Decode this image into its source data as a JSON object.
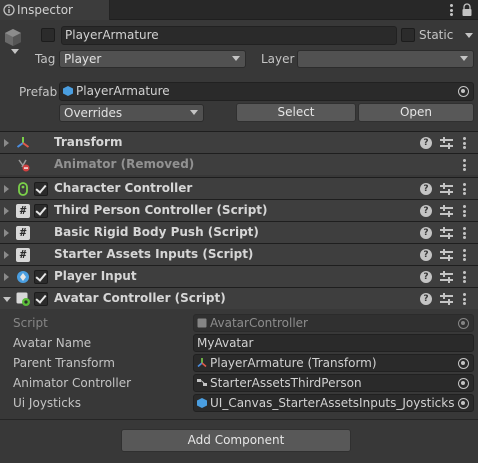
{
  "window": {
    "tab_title": "Inspector"
  },
  "header": {
    "object_name": "PlayerArmature",
    "static_label": "Static",
    "tag_label": "Tag",
    "tag_value": "Player",
    "layer_label": "Layer",
    "layer_value": "",
    "prefab_label": "Prefab",
    "prefab_value": "PlayerArmature",
    "overrides_label": "Overrides",
    "select_label": "Select",
    "open_label": "Open"
  },
  "components": [
    {
      "title": "Transform",
      "icon": "transform-icon",
      "has_checkbox": false,
      "checked": false
    },
    {
      "title": "Animator (Removed)",
      "icon": "animator-removed-icon",
      "has_checkbox": false,
      "checked": false
    },
    {
      "title": "Character Controller",
      "icon": "character-controller-icon",
      "has_checkbox": true,
      "checked": true
    },
    {
      "title": "Third Person Controller (Script)",
      "icon": "script-icon",
      "has_checkbox": true,
      "checked": true
    },
    {
      "title": "Basic Rigid Body Push (Script)",
      "icon": "script-icon",
      "has_checkbox": false,
      "checked": false
    },
    {
      "title": "Starter Assets Inputs (Script)",
      "icon": "script-icon",
      "has_checkbox": false,
      "checked": false
    },
    {
      "title": "Player Input",
      "icon": "player-input-icon",
      "has_checkbox": true,
      "checked": true
    },
    {
      "title": "Avatar Controller (Script)",
      "icon": "avatar-script-icon",
      "has_checkbox": true,
      "checked": true
    }
  ],
  "avatar_controller": {
    "script_label": "Script",
    "script_value": "AvatarController",
    "avatar_name_label": "Avatar Name",
    "avatar_name_value": "MyAvatar",
    "parent_transform_label": "Parent Transform",
    "parent_transform_value": "PlayerArmature (Transform)",
    "animator_controller_label": "Animator Controller",
    "animator_controller_value": "StarterAssetsThirdPerson",
    "ui_joysticks_label": "Ui Joysticks",
    "ui_joysticks_value": "UI_Canvas_StarterAssetsInputs_Joysticks"
  },
  "footer": {
    "add_component_label": "Add Component"
  },
  "colors": {
    "background": "#383838",
    "component_header": "#3e3e3e",
    "field": "#2a2a2a",
    "prefab_blue": "#4a9ee0"
  }
}
